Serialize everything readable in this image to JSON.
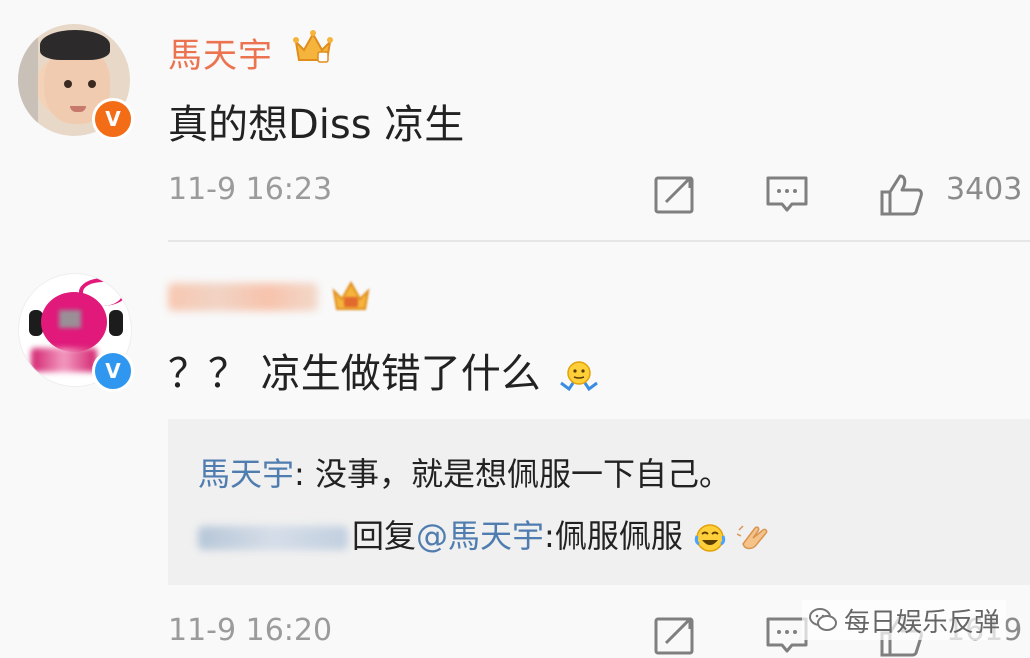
{
  "posts": [
    {
      "username": "馬天宇",
      "badge": "V",
      "text": "真的想Diss 凉生",
      "timestamp": "11-9 16:23",
      "like_count": "3403"
    },
    {
      "username": "",
      "badge": "V",
      "text": "？？ 凉生做错了什么",
      "reply": {
        "line1_name": "馬天宇",
        "line1_text": ": 没事，就是想佩服一下自己。",
        "line2_reply_word": "回复",
        "line2_mention": "@馬天宇",
        "line2_text": ":佩服佩服"
      },
      "timestamp": "11-9 16:20",
      "like_count": "1619"
    }
  ],
  "icons": {
    "share": "share-icon",
    "comment": "comment-icon",
    "like": "thumbs-up-icon",
    "crown": "crown-icon",
    "wechat": "wechat-icon"
  },
  "colors": {
    "username": "#eb7350",
    "link": "#507daf",
    "timestamp": "#9b9b9b",
    "badge_orange": "#f36d16",
    "badge_blue": "#2f97f0"
  },
  "watermark": {
    "text": "每日娱乐反弹"
  }
}
